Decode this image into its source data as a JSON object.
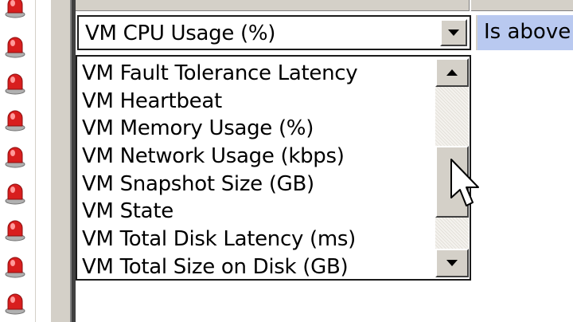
{
  "condition": {
    "metric_value": "VM CPU Usage (%)",
    "operator_value": "Is above"
  },
  "dropdown": {
    "items": [
      "VM Fault Tolerance Latency",
      "VM Heartbeat",
      "VM Memory Usage (%)",
      "VM Network Usage (kbps)",
      "VM Snapshot Size (GB)",
      "VM State",
      "VM Total Disk Latency (ms)",
      "VM Total Size on Disk (GB)"
    ]
  },
  "icons": {
    "alarm": "alarm-icon",
    "combo_arrow": "chevron-down-icon",
    "scroll_up": "scroll-up-arrow-icon",
    "scroll_down": "scroll-down-arrow-icon",
    "cursor": "mouse-pointer-icon"
  },
  "colors": {
    "window_face": "#d4d0c8",
    "selection_blue": "#b9c9f0",
    "alarm_red": "#d81e1e"
  }
}
